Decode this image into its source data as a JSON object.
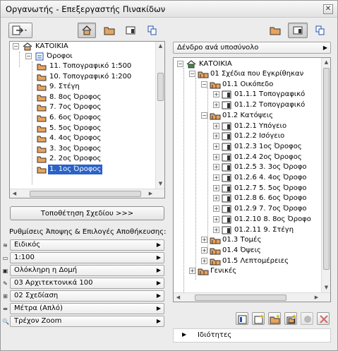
{
  "window": {
    "title": "Οργανωτής - Επεξεργαστής Πινακίδων",
    "close": "✕"
  },
  "left": {
    "root": "ΚΑΤΟΙΚΙΑ",
    "group": "Όροφοι",
    "items": [
      "11. Τοπογραφικό 1:500",
      "10. Τοπογραφικό 1:200",
      "9. Στέγη",
      "8. 8ος Όροφος",
      "7. 7ος Όροφος",
      "6. 6ος Όροφος",
      "5. 5ος Όροφος",
      "4. 4ος Όροφος",
      "3. 3ος Όροφος",
      "2. 2ος Όροφος",
      "1. 1ος Όροφος"
    ],
    "place_button": "Τοποθέτηση Σχεδίου >>>",
    "settings_label": "Ρυθμίσεις Άποψης & Επιλογές Αποθήκευσης:",
    "settings": [
      {
        "icon": "layers-icon",
        "glyph": "≋",
        "value": "Ειδικός"
      },
      {
        "icon": "scale-icon",
        "glyph": "▭",
        "value": "1:100"
      },
      {
        "icon": "structure-icon",
        "glyph": "▣",
        "value": "Ολόκληρη η Δομή"
      },
      {
        "icon": "pen-icon",
        "glyph": "✎",
        "value": "03 Αρχιτεκτονικά 100"
      },
      {
        "icon": "dimension-icon",
        "glyph": "⊞",
        "value": "02 Σχεδίαση"
      },
      {
        "icon": "dimension-style-icon",
        "glyph": "⇹",
        "value": "Μέτρα (Απλό)"
      },
      {
        "icon": "zoom-icon",
        "glyph": "🔍",
        "value": "Τρέχον Zoom"
      }
    ]
  },
  "right": {
    "view_select": "Δένδρο ανά υποσύνολο",
    "root": "ΚΑΤΟΙΚΙΑ",
    "tree": [
      {
        "text": "01 Σχέδια που Εγκρίθηκαν",
        "level": 1,
        "kind": "folder",
        "exp": "−"
      },
      {
        "text": "01.1 Οικόπεδο",
        "level": 2,
        "kind": "folder",
        "exp": "−"
      },
      {
        "text": "01.1.1 Τοπογραφικό",
        "level": 3,
        "kind": "layout",
        "exp": "+"
      },
      {
        "text": "01.1.2 Τοπογραφικό",
        "level": 3,
        "kind": "layout",
        "exp": "+"
      },
      {
        "text": "01.2 Κατόψεις",
        "level": 2,
        "kind": "folder",
        "exp": "−"
      },
      {
        "text": "01.2.1 Υπόγειο",
        "level": 3,
        "kind": "layout",
        "exp": "+"
      },
      {
        "text": "01.2.2 Ισόγειο",
        "level": 3,
        "kind": "layout",
        "exp": "+"
      },
      {
        "text": "01.2.3 1ος Όροφος",
        "level": 3,
        "kind": "layout",
        "exp": "+"
      },
      {
        "text": "01.2.4 2ος Όροφος",
        "level": 3,
        "kind": "layout",
        "exp": "+"
      },
      {
        "text": "01.2.5 3. 3ος Όροφο",
        "level": 3,
        "kind": "layout",
        "exp": "+"
      },
      {
        "text": "01.2.6 4. 4ος Όροφο",
        "level": 3,
        "kind": "layout",
        "exp": "+"
      },
      {
        "text": "01.2.7 5. 5ος Όροφο",
        "level": 3,
        "kind": "layout",
        "exp": "+"
      },
      {
        "text": "01.2.8 6. 6ος Όροφο",
        "level": 3,
        "kind": "layout",
        "exp": "+"
      },
      {
        "text": "01.2.9 7. 7ος Όροφο",
        "level": 3,
        "kind": "layout",
        "exp": "+"
      },
      {
        "text": "01.2.10 8. 8ος Όροφο",
        "level": 3,
        "kind": "layout",
        "exp": "+"
      },
      {
        "text": "01.2.11 9. Στέγη",
        "level": 3,
        "kind": "layout",
        "exp": "+"
      },
      {
        "text": "01.3 Τομές",
        "level": 2,
        "kind": "folder",
        "exp": "+"
      },
      {
        "text": "01.4 Όψεις",
        "level": 2,
        "kind": "folder",
        "exp": "+"
      },
      {
        "text": "01.5 Λεπτομέρειες",
        "level": 2,
        "kind": "folder",
        "exp": "+"
      },
      {
        "text": "Γενικές",
        "level": 1,
        "kind": "folder",
        "exp": "+"
      }
    ],
    "properties": "Ιδιότητες"
  },
  "colors": {
    "selection": "#2a62c7",
    "folder": "#e9a35b",
    "home_green": "#3f8f3f"
  }
}
